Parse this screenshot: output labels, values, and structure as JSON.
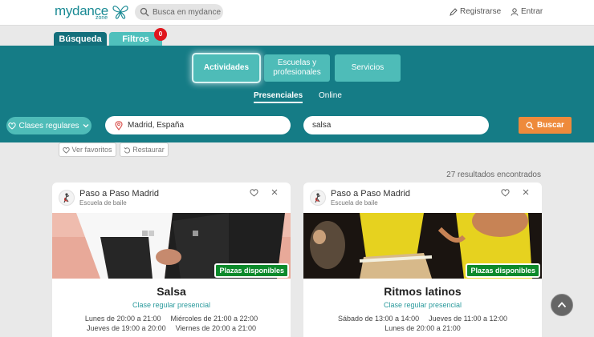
{
  "header": {
    "logo_text": "mydance",
    "logo_sub": "zone",
    "search_placeholder": "Busca en mydance",
    "register_label": "Registrarse",
    "login_label": "Entrar"
  },
  "tabs": {
    "search_label": "Búsqueda",
    "filters_label": "Filtros",
    "filters_count": "0"
  },
  "categories": [
    {
      "label": "Actividades"
    },
    {
      "label": "Escuelas y profesionales"
    },
    {
      "label": "Servicios"
    }
  ],
  "modes": [
    {
      "label": "Presenciales"
    },
    {
      "label": "Online"
    }
  ],
  "filters": {
    "type_label": "Clases regulares",
    "location_value": "Madrid, España",
    "query_value": "salsa",
    "search_button": "Buscar",
    "favorites_button": "Ver favoritos",
    "reset_button": "Restaurar"
  },
  "results_text": "27 resultados encontrados",
  "cards": [
    {
      "school": "Paso a Paso Madrid",
      "type": "Escuela de baile",
      "badge": "Plazas disponibles",
      "title": "Salsa",
      "subtitle": "Clase regular presencial",
      "schedule": [
        [
          "Lunes de 20:00 a 21:00",
          "Miércoles de 21:00 a 22:00"
        ],
        [
          "Jueves de 19:00 a 20:00",
          "Viernes de 20:00 a 21:00"
        ]
      ]
    },
    {
      "school": "Paso a Paso Madrid",
      "type": "Escuela de baile",
      "badge": "Plazas disponibles",
      "title": "Ritmos latinos",
      "subtitle": "Clase regular presencial",
      "schedule": [
        [
          "Sábado de 13:00 a 14:00",
          "Jueves de 11:00 a 12:00"
        ],
        [
          "Lunes de 20:00 a 21:00"
        ]
      ]
    }
  ],
  "colors": {
    "teal_dark": "#157c86",
    "teal_light": "#4ebcb8",
    "orange": "#ee8a3b",
    "green_badge": "#0c8a2b",
    "red_badge": "#e0161d"
  }
}
